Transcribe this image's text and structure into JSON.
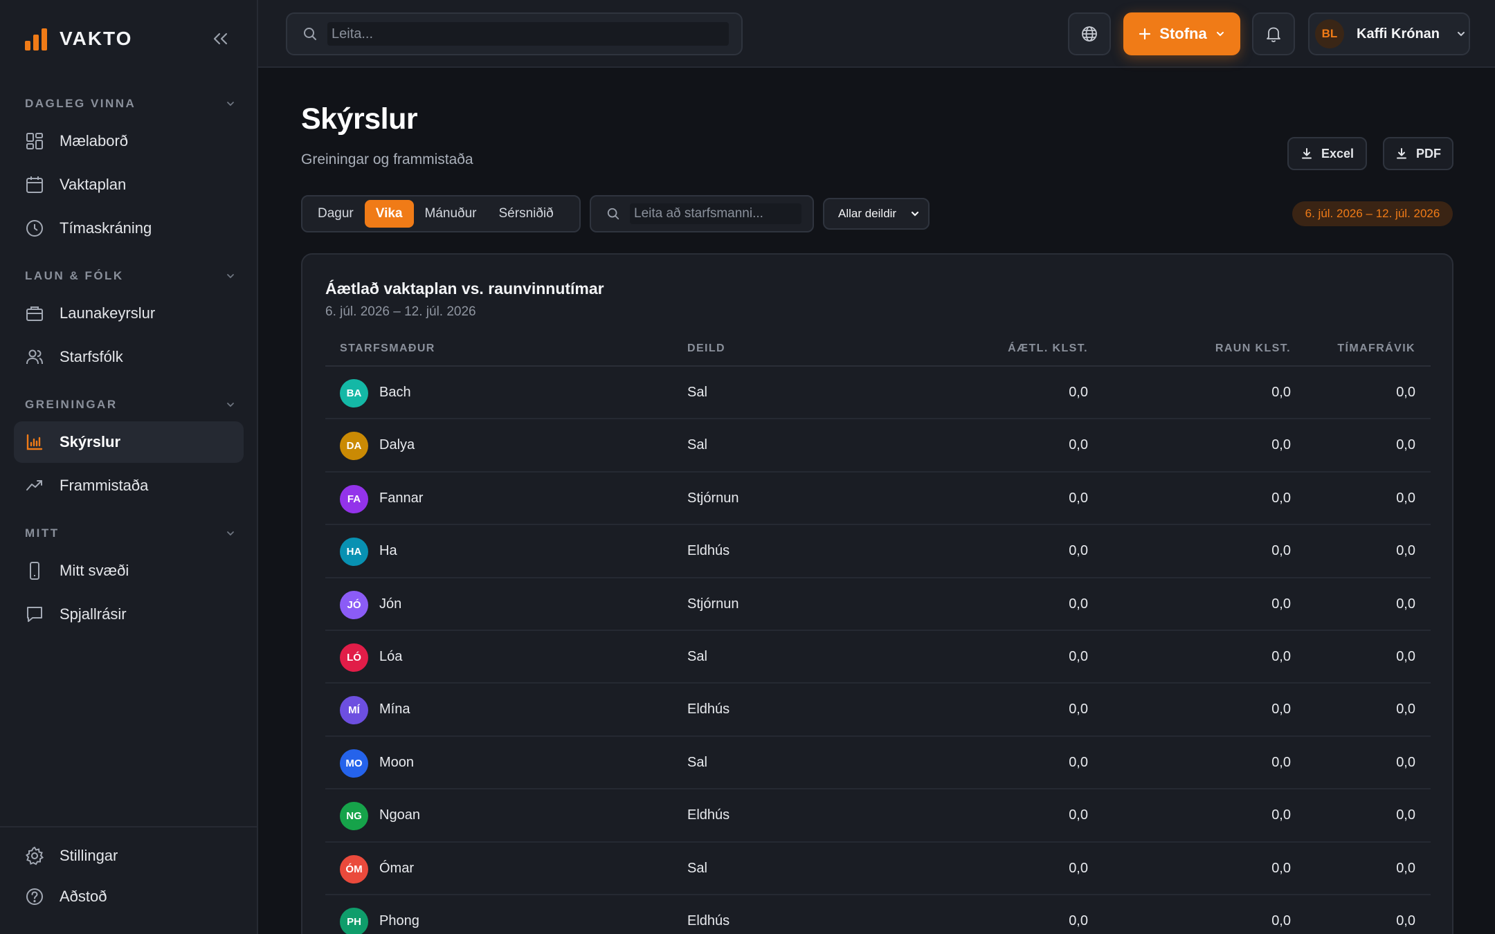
{
  "app": {
    "name": "VAKTO"
  },
  "sidebar": {
    "sections": [
      {
        "label": "DAGLEG VINNA",
        "items": [
          {
            "label": "Mælaborð",
            "icon": "dashboard-grid-icon"
          },
          {
            "label": "Vaktaplan",
            "icon": "calendar-icon"
          },
          {
            "label": "Tímaskráning",
            "icon": "clock-icon"
          }
        ]
      },
      {
        "label": "LAUN & FÓLK",
        "items": [
          {
            "label": "Launakeyrslur",
            "icon": "wallet-icon"
          },
          {
            "label": "Starfsfólk",
            "icon": "users-icon"
          }
        ]
      },
      {
        "label": "GREININGAR",
        "items": [
          {
            "label": "Skýrslur",
            "icon": "bar-chart-icon",
            "active": true
          },
          {
            "label": "Frammistaða",
            "icon": "trend-line-icon"
          }
        ]
      },
      {
        "label": "MITT",
        "items": [
          {
            "label": "Mitt svæði",
            "icon": "smartphone-icon"
          },
          {
            "label": "Spjallrásir",
            "icon": "chat-bubble-icon"
          }
        ]
      }
    ],
    "footer": [
      {
        "label": "Stillingar",
        "icon": "gear-icon"
      },
      {
        "label": "Aðstoð",
        "icon": "help-circle-icon"
      }
    ]
  },
  "topbar": {
    "search_placeholder": "Leita...",
    "create_label": "Stofna",
    "account": {
      "initials": "BL",
      "name": "Kaffi Krónan"
    }
  },
  "page": {
    "title": "Skýrslur",
    "subtitle": "Greiningar og frammistaða",
    "export_excel": "Excel",
    "export_pdf": "PDF",
    "period_tabs": [
      {
        "label": "Dagur",
        "active": false
      },
      {
        "label": "Vika",
        "active": true
      },
      {
        "label": "Mánuður",
        "active": false
      },
      {
        "label": "Sérsniðið",
        "active": false
      }
    ],
    "employee_search_placeholder": "Leita að starfsmanni...",
    "department_filter": "Allar deildir",
    "date_range": "6. júl. 2026 – 12. júl. 2026"
  },
  "report": {
    "title": "Áætlað vaktaplan vs. raunvinnutímar",
    "subtitle": "6. júl. 2026 – 12. júl. 2026",
    "columns": [
      "STARFSMAÐUR",
      "DEILD",
      "ÁÆTL. KLST.",
      "RAUN KLST.",
      "TÍMAFRÁVIK"
    ],
    "rows": [
      {
        "initials": "BA",
        "name": "Bach",
        "dept": "Sal",
        "planned": "0,0",
        "actual": "0,0",
        "variance": "0,0",
        "color": "#14b8a6"
      },
      {
        "initials": "DA",
        "name": "Dalya",
        "dept": "Sal",
        "planned": "0,0",
        "actual": "0,0",
        "variance": "0,0",
        "color": "#ca8a04"
      },
      {
        "initials": "FA",
        "name": "Fannar",
        "dept": "Stjórnun",
        "planned": "0,0",
        "actual": "0,0",
        "variance": "0,0",
        "color": "#9333ea"
      },
      {
        "initials": "HA",
        "name": "Ha",
        "dept": "Eldhús",
        "planned": "0,0",
        "actual": "0,0",
        "variance": "0,0",
        "color": "#0891b2"
      },
      {
        "initials": "JÓ",
        "name": "Jón",
        "dept": "Stjórnun",
        "planned": "0,0",
        "actual": "0,0",
        "variance": "0,0",
        "color": "#8b5cf6"
      },
      {
        "initials": "LÓ",
        "name": "Lóa",
        "dept": "Sal",
        "planned": "0,0",
        "actual": "0,0",
        "variance": "0,0",
        "color": "#e11d48"
      },
      {
        "initials": "MÍ",
        "name": "Mína",
        "dept": "Eldhús",
        "planned": "0,0",
        "actual": "0,0",
        "variance": "0,0",
        "color": "#6d4fe0"
      },
      {
        "initials": "MO",
        "name": "Moon",
        "dept": "Sal",
        "planned": "0,0",
        "actual": "0,0",
        "variance": "0,0",
        "color": "#2563eb"
      },
      {
        "initials": "NG",
        "name": "Ngoan",
        "dept": "Eldhús",
        "planned": "0,0",
        "actual": "0,0",
        "variance": "0,0",
        "color": "#16a34a"
      },
      {
        "initials": "ÓM",
        "name": "Ómar",
        "dept": "Sal",
        "planned": "0,0",
        "actual": "0,0",
        "variance": "0,0",
        "color": "#ea4a3c"
      },
      {
        "initials": "PH",
        "name": "Phong",
        "dept": "Eldhús",
        "planned": "0,0",
        "actual": "0,0",
        "variance": "0,0",
        "color": "#0f9d6b"
      }
    ]
  },
  "colors": {
    "accent": "#f07b17",
    "background": "#111318",
    "panel": "#1a1d24"
  }
}
